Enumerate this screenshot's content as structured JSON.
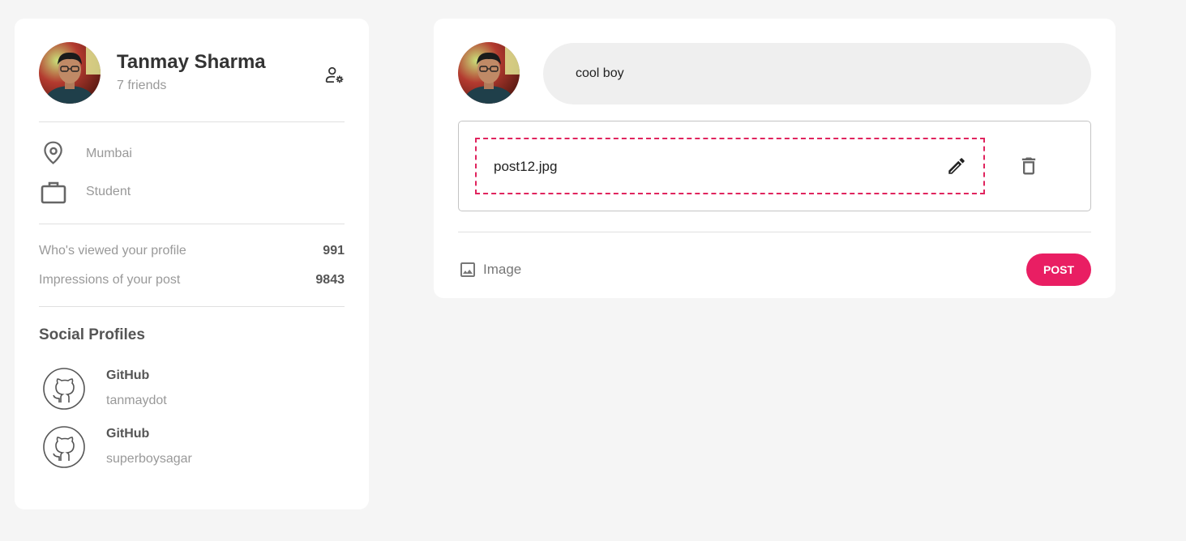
{
  "profile": {
    "name": "Tanmay Sharma",
    "friends": "7 friends",
    "location": "Mumbai",
    "occupation": "Student",
    "stats": [
      {
        "label": "Who's viewed your profile",
        "value": "991"
      },
      {
        "label": "Impressions of your post",
        "value": "9843"
      }
    ],
    "social_title": "Social Profiles",
    "socials": [
      {
        "platform": "GitHub",
        "handle": "tanmaydot",
        "icon": "github-icon"
      },
      {
        "platform": "GitHub",
        "handle": "superboysagar",
        "icon": "github-icon"
      }
    ]
  },
  "composer": {
    "input_value": "cool boy",
    "attachment": {
      "file_name": "post12.jpg"
    },
    "image_label": "Image",
    "post_label": "POST"
  },
  "colors": {
    "accent": "#e91e63",
    "background": "#f5f5f5",
    "card": "#ffffff",
    "muted_text": "#999999"
  }
}
